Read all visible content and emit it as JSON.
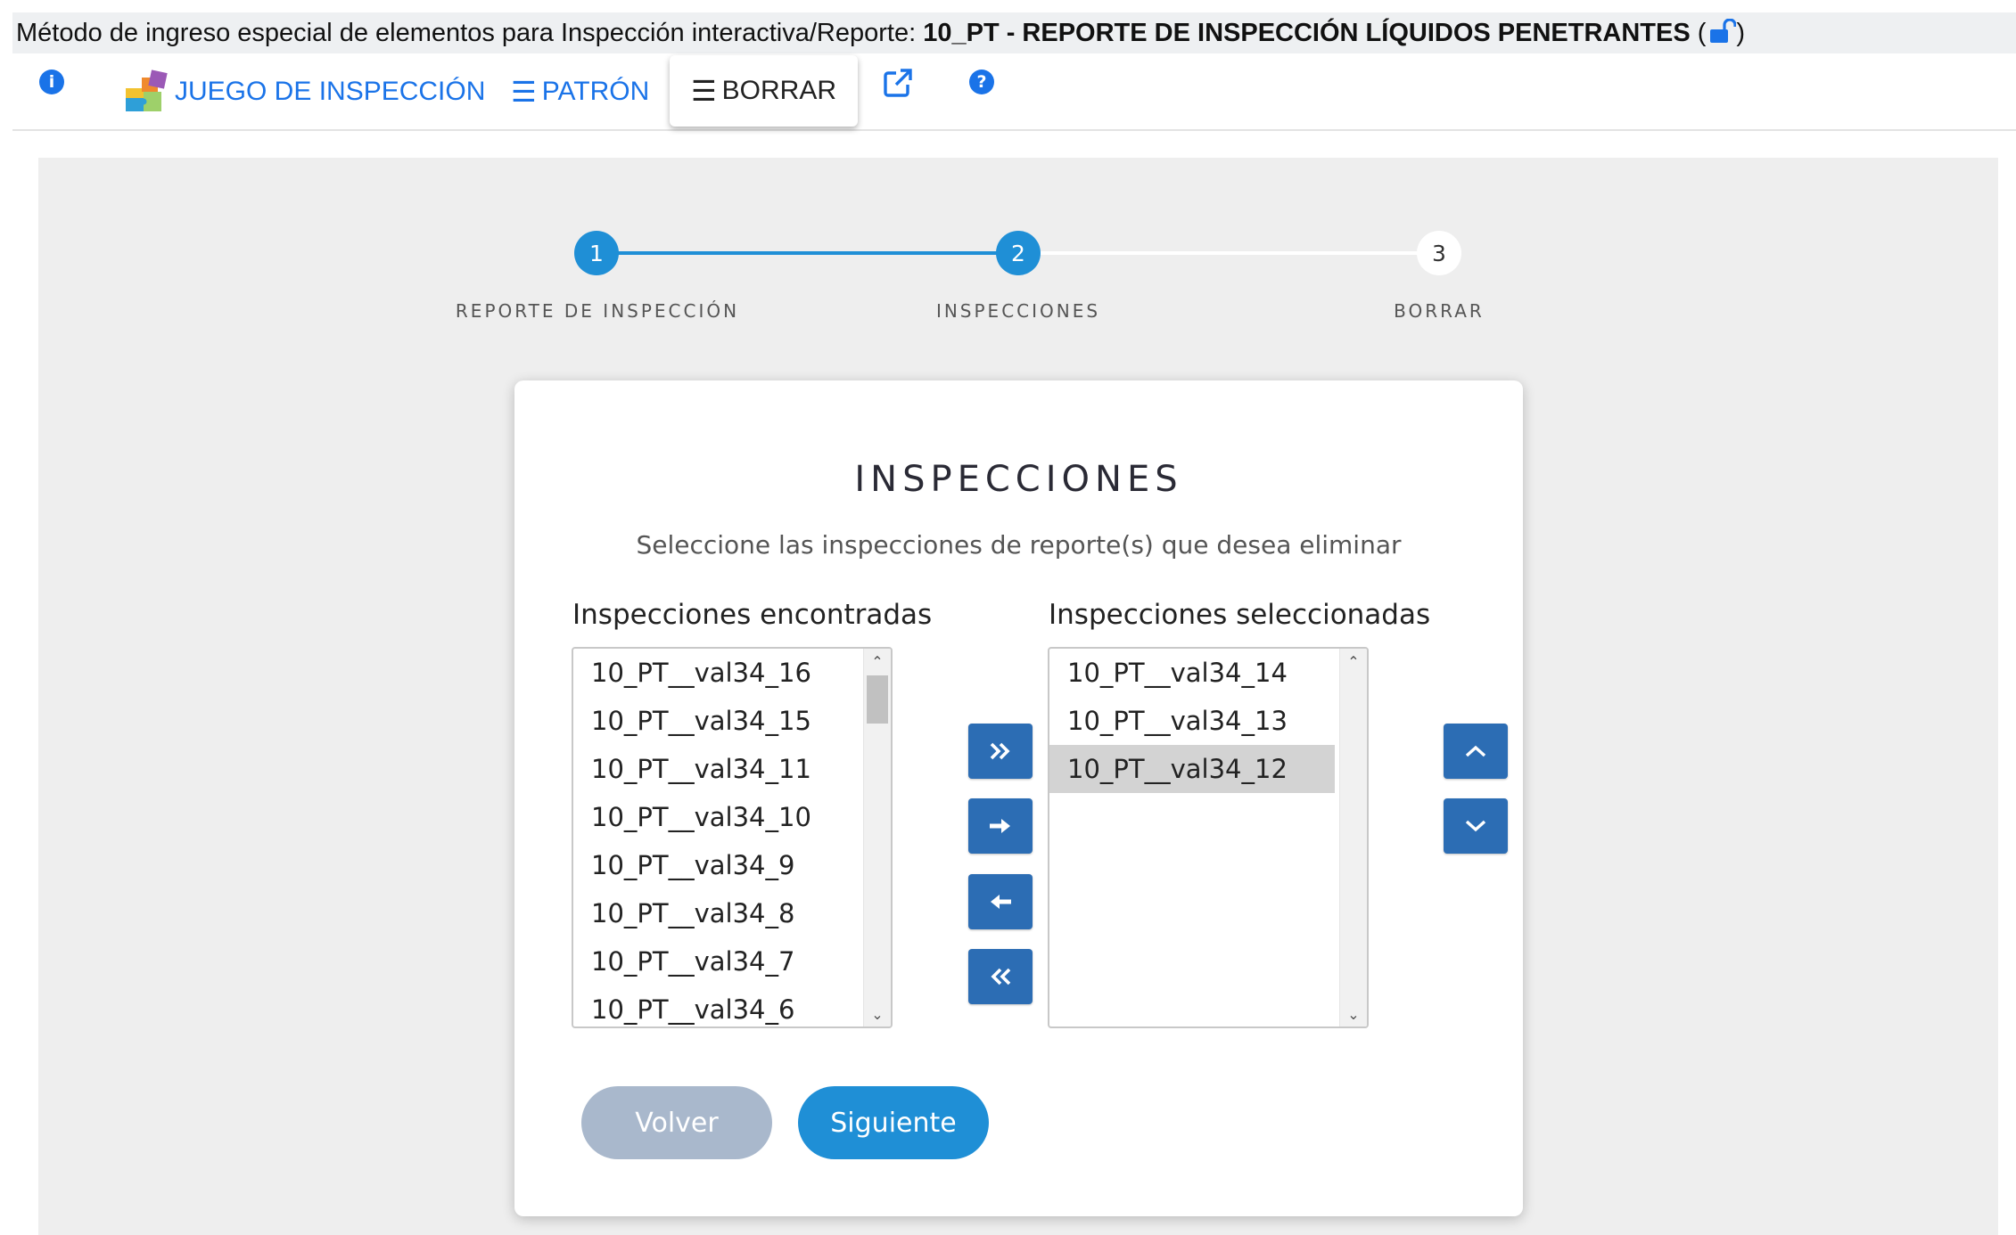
{
  "title": {
    "prefix": "Método de ingreso especial de elementos para Inspección interactiva/Reporte: ",
    "bold": "10_PT - REPORTE DE INSPECCIÓN LÍQUIDOS PENETRANTES",
    "open_paren": " (",
    "close_paren": ")"
  },
  "toolbar": {
    "info_glyph": "i",
    "juego_label": "JUEGO DE INSPECCIÓN",
    "patron_label": "PATRÓN",
    "borrar_label": "BORRAR",
    "help_glyph": "?",
    "hamburger_glyph": "☰"
  },
  "stepper": {
    "steps": [
      {
        "number": "1",
        "label": "REPORTE DE INSPECCIÓN",
        "state": "done"
      },
      {
        "number": "2",
        "label": "INSPECCIONES",
        "state": "current"
      },
      {
        "number": "3",
        "label": "BORRAR",
        "state": "todo"
      }
    ]
  },
  "card": {
    "title": "INSPECCIONES",
    "subtitle": "Seleccione las inspecciones de reporte(s) que desea eliminar",
    "found_label": "Inspecciones encontradas",
    "selected_label": "Inspecciones seleccionadas",
    "found_items": [
      "10_PT__val34_16",
      "10_PT__val34_15",
      "10_PT__val34_11",
      "10_PT__val34_10",
      "10_PT__val34_9",
      "10_PT__val34_8",
      "10_PT__val34_7",
      "10_PT__val34_6"
    ],
    "selected_items": [
      "10_PT__val34_14",
      "10_PT__val34_13",
      "10_PT__val34_12"
    ],
    "highlighted_selected": "10_PT__val34_12",
    "back_label": "Volver",
    "next_label": "Siguiente"
  },
  "colors": {
    "accent_blue": "#1a73e8",
    "step_blue": "#1f8fd6",
    "transfer_button": "#2c6db4",
    "back_button": "#a9b8cc",
    "content_bg": "#eeeeee"
  },
  "icons": [
    "info-icon",
    "puzzle-icon",
    "hamburger-icon",
    "external-link-icon",
    "help-icon",
    "unlock-icon",
    "double-chevron-right-icon",
    "arrow-right-icon",
    "arrow-left-icon",
    "double-chevron-left-icon",
    "chevron-up-icon",
    "chevron-down-icon"
  ]
}
